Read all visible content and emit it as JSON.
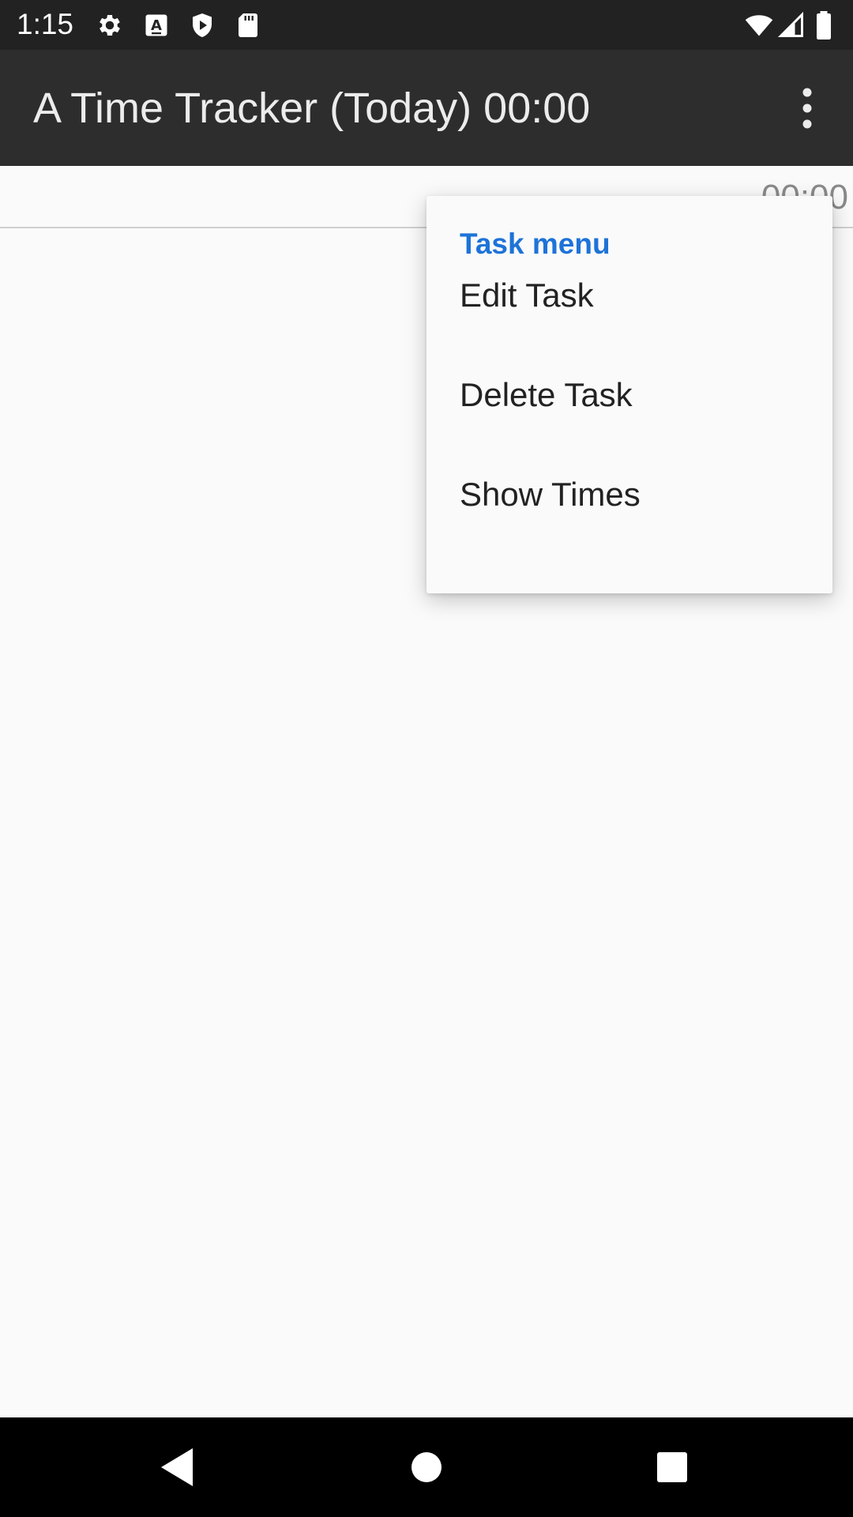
{
  "status_bar": {
    "time": "1:15",
    "icons": [
      "gear-icon",
      "font-a-icon",
      "shield-play-icon",
      "sd-card-icon",
      "wifi-icon",
      "cell-signal-icon",
      "battery-icon"
    ]
  },
  "app_bar": {
    "title": "A Time Tracker (Today) 00:00",
    "overflow_icon": "more-vert-icon"
  },
  "task_list": {
    "rows": [
      {
        "time": "00:00"
      }
    ]
  },
  "popup_menu": {
    "header": "Task menu",
    "items": [
      {
        "label": "Edit Task"
      },
      {
        "label": "Delete Task"
      },
      {
        "label": "Show Times"
      }
    ],
    "header_color": "#1e73d8"
  },
  "nav_bar": {
    "icons": [
      "back-icon",
      "home-icon",
      "recents-icon"
    ]
  },
  "colors": {
    "status_bar": "#222222",
    "app_bar": "#2d2d2d",
    "background": "#fafafa",
    "nav_bar": "#000000"
  }
}
